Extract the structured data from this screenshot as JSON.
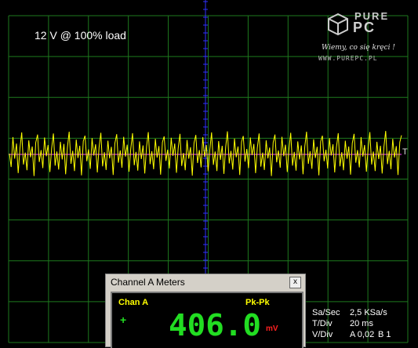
{
  "window": {
    "title": "12 V @ 100% load"
  },
  "logo": {
    "word1": "PURE",
    "word2": "PC",
    "slogan": "Wiemy, co się kręci !",
    "url": "WWW.PUREPC.PL"
  },
  "trigger_marker": "T",
  "meters": {
    "title": "Channel A Meters",
    "close_label": "x",
    "channel_label": "Chan A",
    "measure_label": "Pk-Pk",
    "sign": "+",
    "value": "406.0",
    "unit": "mV"
  },
  "settings": {
    "sa_sec_label": "Sa/Sec",
    "sa_sec_value": "2,5 KSa/s",
    "t_div_label": "T/Div",
    "t_div_value": "20 ms",
    "v_div_label": "V/Div",
    "v_div_a": "A 0,02",
    "v_div_b": "B 1"
  },
  "colors": {
    "grid": "#1e7a1e",
    "trace": "#ffff00",
    "center_axis": "#3030ff",
    "trigger_line": "#ff40ff",
    "digit": "#22dd22"
  },
  "chart_data": {
    "type": "line",
    "title": "12 V @ 100% load",
    "xlabel": "",
    "ylabel": "",
    "grid": true,
    "x_div": 10,
    "y_div": 8,
    "series": [
      {
        "values": [
          0.02,
          -0.35,
          0.48,
          -0.12,
          0.3,
          -0.52,
          0.18,
          0.61,
          -0.28,
          0.05,
          -0.44,
          0.39,
          -0.08,
          0.22,
          -0.6,
          0.33,
          0.55,
          -0.21,
          0.12,
          -0.38,
          0.47,
          -0.05,
          0.26,
          -0.49,
          0.16,
          0.58,
          -0.31,
          0.08,
          -0.42,
          0.35,
          -0.14,
          0.29,
          -0.55,
          0.2,
          0.63,
          -0.26,
          0.1,
          -0.46,
          0.41,
          -0.1,
          0.24,
          -0.58,
          0.37,
          0.52,
          -0.19,
          0.14,
          -0.4,
          0.45,
          -0.03,
          0.28,
          -0.5,
          0.19,
          0.6,
          -0.33,
          0.06,
          -0.43,
          0.38,
          -0.11,
          0.21,
          -0.57,
          0.31,
          0.56,
          -0.23,
          0.11,
          -0.37,
          0.49,
          -0.06,
          0.27,
          -0.48,
          0.15,
          0.59,
          -0.3,
          0.07,
          -0.45,
          0.36,
          -0.13,
          0.25,
          -0.53,
          0.22,
          0.62,
          -0.27,
          0.09,
          -0.41,
          0.43,
          -0.09,
          0.23,
          -0.56,
          0.34,
          0.5,
          -0.18,
          0.13,
          -0.39,
          0.46,
          -0.04,
          0.3,
          -0.51,
          0.17,
          0.57,
          -0.32,
          0.04,
          -0.44,
          0.4,
          -0.12,
          0.2,
          -0.59,
          0.32,
          0.54,
          -0.24,
          0.12,
          -0.36,
          0.48,
          -0.07,
          0.26,
          -0.47,
          0.14,
          0.61,
          -0.29,
          0.08,
          -0.46,
          0.37,
          -0.15,
          0.24,
          -0.54,
          0.21,
          0.64,
          -0.25,
          0.1,
          -0.42,
          0.44,
          -0.08,
          0.22,
          -0.57,
          0.35,
          0.51,
          -0.2,
          0.15,
          -0.38,
          0.47,
          -0.02,
          0.29,
          -0.52,
          0.18,
          0.58,
          -0.34,
          0.05,
          -0.43,
          0.39,
          -0.11,
          0.19,
          -0.6,
          0.33,
          0.55,
          -0.22,
          0.11,
          -0.37,
          0.49,
          -0.05,
          0.27,
          -0.49,
          0.16,
          0.6,
          -0.31,
          0.07,
          -0.45,
          0.36,
          -0.14,
          0.25,
          -0.55,
          0.23,
          0.63,
          -0.26,
          0.09,
          -0.4,
          0.42,
          -0.1,
          0.21,
          -0.58,
          0.36,
          0.52,
          -0.19,
          0.13,
          -0.39,
          0.45,
          -0.03,
          0.28,
          -0.5,
          0.2,
          0.59,
          -0.33,
          0.06,
          -0.44,
          0.38,
          -0.12,
          0.22,
          -0.56,
          0.31,
          0.57,
          -0.23,
          0.12,
          -0.36,
          0.48,
          -0.06,
          0.26,
          -0.48,
          0.15,
          0.62,
          -0.28,
          0.08,
          -0.46,
          0.35,
          -0.13,
          0.24,
          -0.53,
          0.22,
          0.65,
          -0.27,
          0.1,
          -0.41,
          0.43,
          -0.09,
          0.23,
          -0.57,
          0.34,
          0.53
        ]
      }
    ]
  }
}
